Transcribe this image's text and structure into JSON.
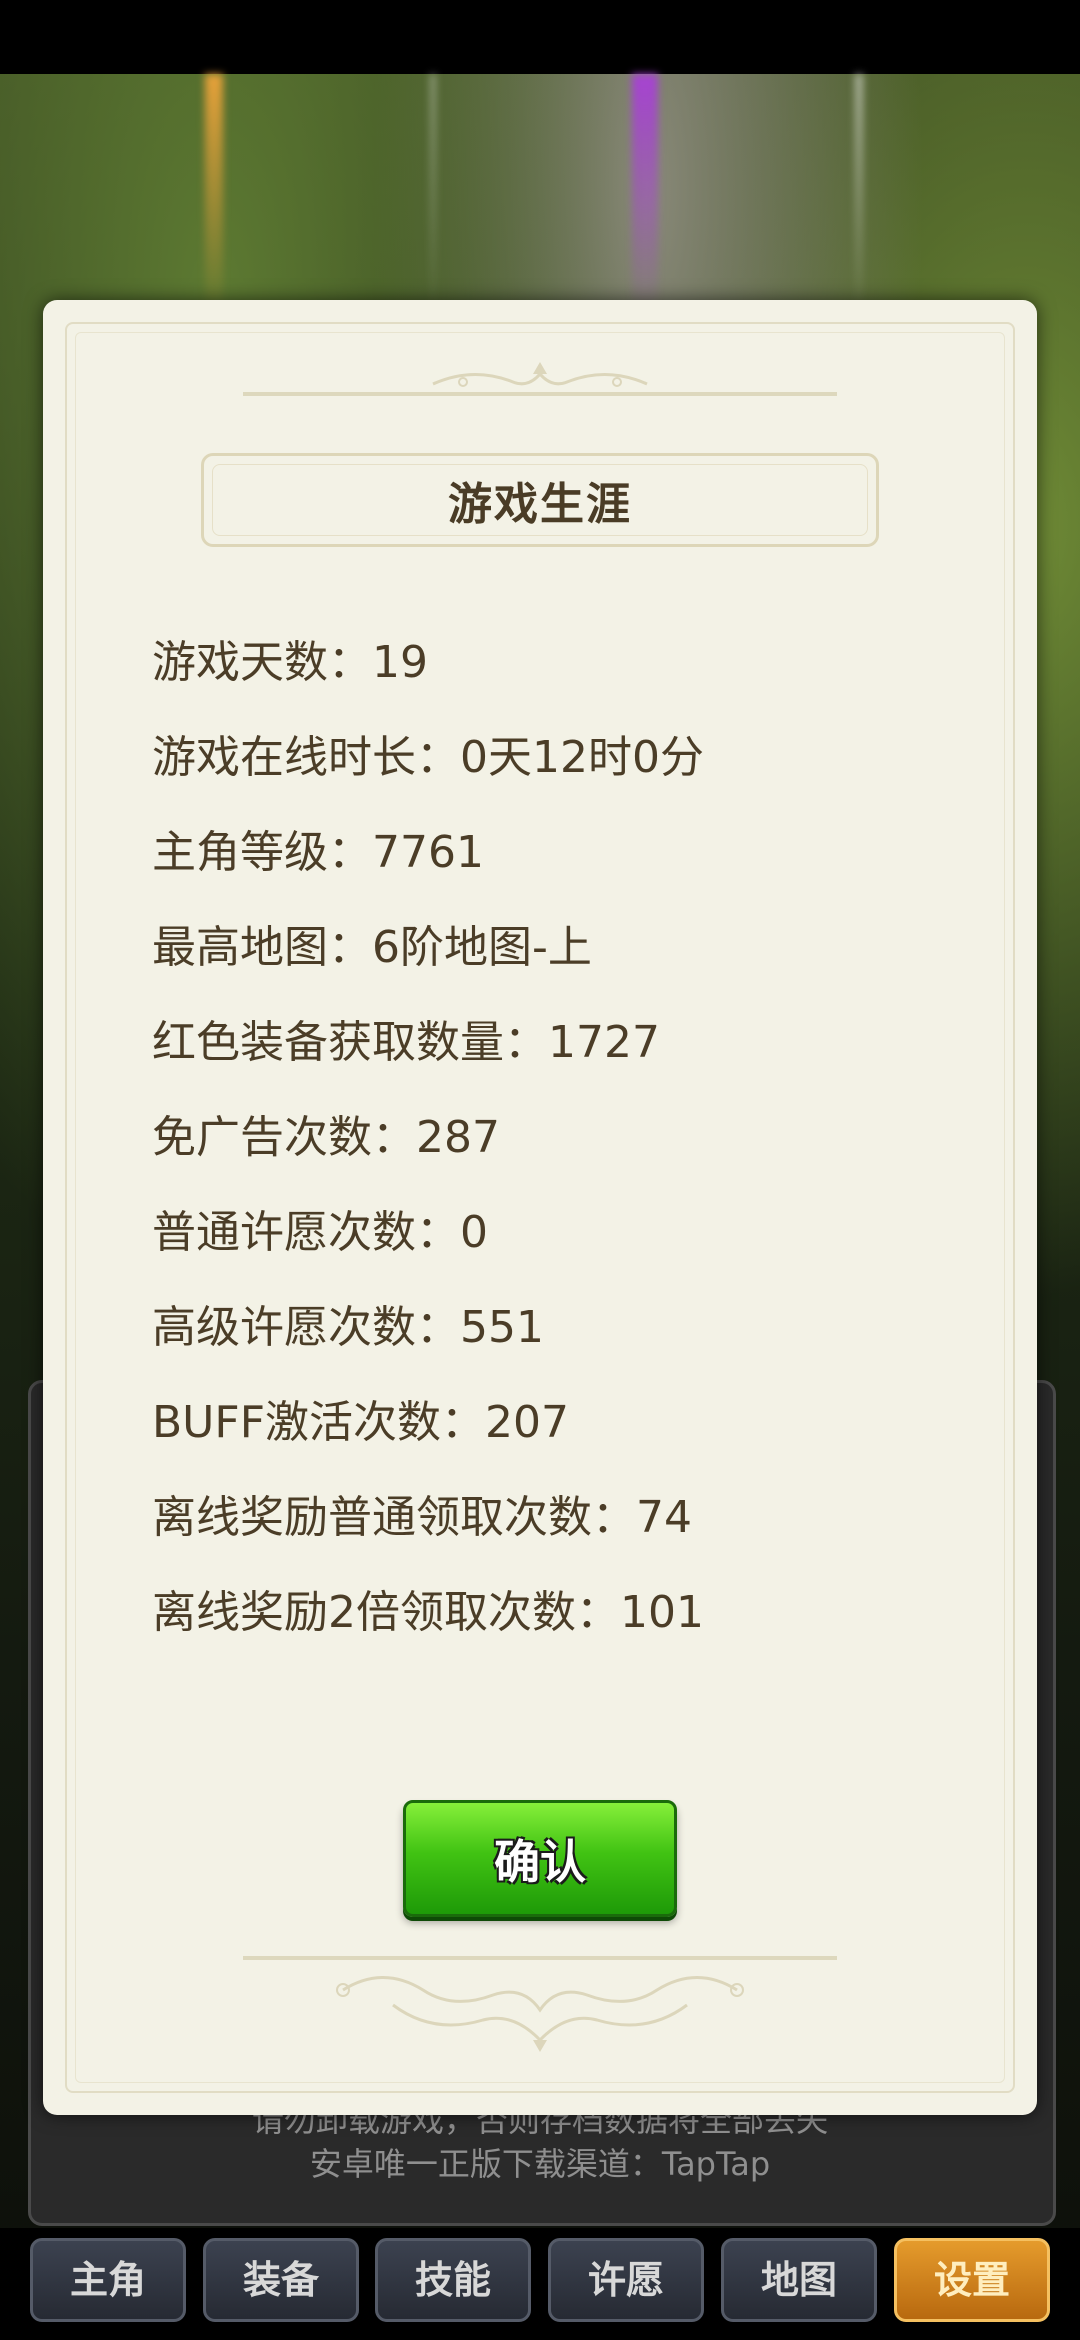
{
  "dialog": {
    "title": "游戏生涯",
    "stats": [
      "游戏天数：19",
      "游戏在线时长：0天12时0分",
      "主角等级：7761",
      "最高地图：6阶地图-上",
      "红色装备获取数量：1727",
      "免广告次数：287",
      "普通许愿次数：0",
      "高级许愿次数：551",
      "BUFF激活次数：207",
      "离线奖励普通领取次数：74",
      "离线奖励2倍领取次数：101"
    ],
    "confirm_label": "确认"
  },
  "background_notice": {
    "line1": "请勿卸载游戏，否则存档数据将全部丢失",
    "line2": "安卓唯一正版下载渠道：TapTap"
  },
  "nav": {
    "tabs": [
      {
        "label": "主角"
      },
      {
        "label": "装备"
      },
      {
        "label": "技能"
      },
      {
        "label": "许愿"
      },
      {
        "label": "地图"
      },
      {
        "label": "设置"
      }
    ],
    "active_tab": "设置"
  },
  "colors": {
    "dialog_bg": "#f3f2e6",
    "text": "#4b3d27",
    "confirm_green": "#41c313",
    "active_tab_orange": "#d3851f"
  }
}
